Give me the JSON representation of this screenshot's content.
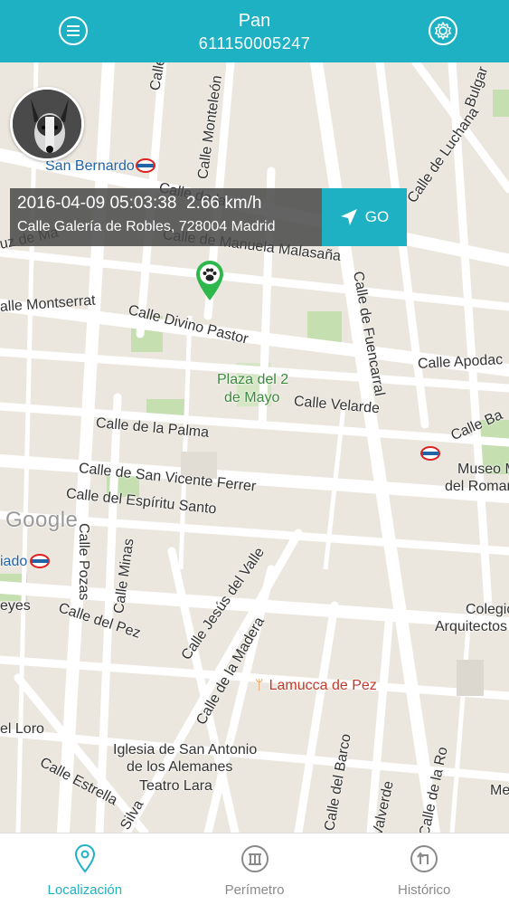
{
  "header": {
    "title": "Pan",
    "subtitle": "611150005247",
    "menu_icon": "hamburger-icon",
    "settings_icon": "gear-icon",
    "color": "#1eb1c3"
  },
  "tracker": {
    "datetime": "2016-04-09 05:03:38",
    "speed": "2.66 km/h",
    "address": "Calle Galería de Robles, 728004 Madrid",
    "go_label": "GO"
  },
  "map": {
    "streets": {
      "calle_upper_left": "Calle",
      "calle_monteleon": "Calle Monteleón",
      "calle_de_luchana": "Calle de Luchana",
      "vulgar_fragment": "Bulgar",
      "calle_de_la_fragment": "Calle de la",
      "calle_manuela_malasana": "Calle de Manuela Malasaña",
      "uz_fragment": "uz de Ma",
      "calle_de_fuencarral": "Calle de Fuencarral",
      "calle_montserrat": "alle Montserrat",
      "calle_divino_pastor": "Calle Divino Pastor",
      "calle_apodaca": "Calle Apodac",
      "calle_velarde": "Calle Velarde",
      "calle_de_la_palma": "Calle de la Palma",
      "calle_ba": "Calle Ba",
      "calle_san_vicente_ferrer": "Calle de San Vicente Ferrer",
      "calle_espiritu_santo": "Calle del Espíritu Santo",
      "calle_pozas": "Calle Pozas",
      "calle_minas": "Calle Minas",
      "calle_jesus_del_valle": "Calle Jesús del Valle",
      "reyes_fragment": "eyes",
      "calle_del_pez": "Calle del Pez",
      "calle_de_la_madera": "Calle de la Madera",
      "del_loro": "el Loro",
      "calle_estrella": "Calle Estrella",
      "silva_fragment": "Silva",
      "calle_del_barco": "Calle del Barco",
      "valverde": "Valverde",
      "calle_ro": "Calle de la Ro"
    },
    "places": {
      "san_bernardo": "San Bernardo",
      "plaza_line1": "Plaza del 2",
      "plaza_line2": "de Mayo",
      "museo_line1": "Museo M",
      "museo_line2": "del Roman",
      "noviciado_fragment": "iado",
      "colegio_line1": "Colegio",
      "colegio_line2": "Arquitectos",
      "lamucca": "Lamucca de Pez",
      "iglesia_line1": "Iglesia de San Antonio",
      "iglesia_line2": "de los Alemanes",
      "teatro_lara": "Teatro Lara",
      "me_fragment": "Me",
      "google": "Google"
    },
    "pin_icon": "paw-pin-icon",
    "pin_color": "#2eb84c"
  },
  "tabs": [
    {
      "label": "Localización",
      "icon": "location-pin-icon",
      "active": true
    },
    {
      "label": "Perímetro",
      "icon": "fence-icon",
      "active": false
    },
    {
      "label": "Histórico",
      "icon": "history-icon",
      "active": false
    }
  ]
}
